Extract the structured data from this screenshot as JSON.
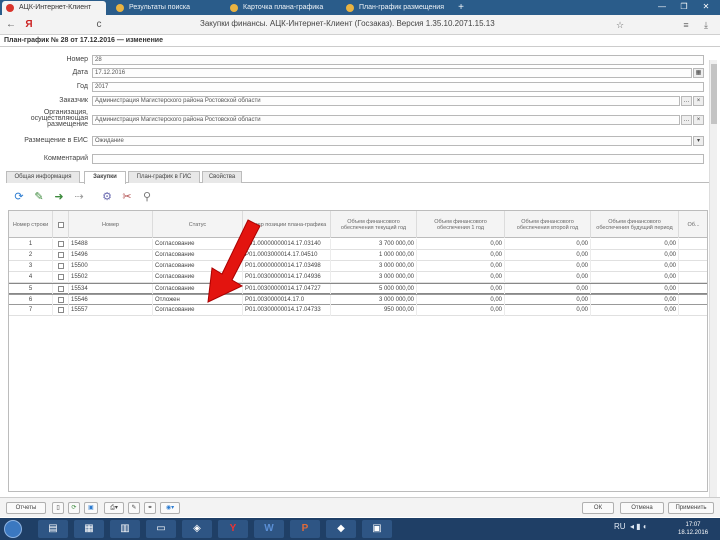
{
  "browser": {
    "tabs": [
      {
        "label": "АЦК-Интернет-Клиент",
        "color": "#d9342b",
        "active": true
      },
      {
        "label": "Результаты поиска",
        "color": "#e9b341",
        "active": false
      },
      {
        "label": "Карточка плана-графика",
        "color": "#e9b341",
        "active": false
      },
      {
        "label": "План-график размещения",
        "color": "#e9b341",
        "active": false
      }
    ],
    "new_tab": "+",
    "back": "←",
    "yandex": "Я",
    "reload": "с",
    "url": "Закупки финансы. АЦК-Интернет-Клиент (Госзаказ). Версия 1.35.10.2071.15.13",
    "window_min": "—",
    "window_max": "❐",
    "window_close": "✕"
  },
  "page": {
    "header": "План-график № 28 от 17.12.2016 — изменение"
  },
  "form": {
    "number_label": "Номер",
    "number_value": "28",
    "date_label": "Дата",
    "date_value": "17.12.2016",
    "year_label": "Год",
    "year_value": "2017",
    "customer_label": "Заказчик",
    "customer_value": "Администрация Магистерского района Ростовской области",
    "org_label": "Организация, осуществляющая размещение",
    "org_value": "Администрация Магистерского района Ростовской области",
    "status_label": "Размещение в ЕИС",
    "status_value": "Ожидание",
    "comment_label": "Комментарий",
    "comment_value": ""
  },
  "content_tabs": [
    {
      "label": "Общая информация",
      "active": false
    },
    {
      "label": "Закупки",
      "active": true
    },
    {
      "label": "План-график в ГИС",
      "active": false
    },
    {
      "label": "Свойства",
      "active": false
    }
  ],
  "toolbar": {
    "icons": [
      "refresh-icon",
      "edit-icon",
      "add-icon",
      "move-icon",
      "settings-icon",
      "tools-icon",
      "filter-icon"
    ]
  },
  "grid": {
    "columns": [
      "Номер строки",
      "",
      "Номер",
      "Статус",
      "Номер позиции плана-графика",
      "Объем финансового обеспечения текущий год",
      "Объем финансового обеспечения 1 год",
      "Объем финансового обеспечения второй год",
      "Объем финансового обеспечения будущий период",
      "Об..."
    ],
    "rows": [
      {
        "line": "1",
        "num": "15488",
        "status": "Согласование",
        "pos": "P01.00000000014.17.03140",
        "cur": "3 700 000,00",
        "y1": "0,00",
        "y2": "0,00",
        "fut": "0,00"
      },
      {
        "line": "2",
        "num": "15496",
        "status": "Согласование",
        "pos": "P01.0003000014.17.04510",
        "cur": "1 000 000,00",
        "y1": "0,00",
        "y2": "0,00",
        "fut": "0,00"
      },
      {
        "line": "3",
        "num": "15500",
        "status": "Согласование",
        "pos": "P01.00000000014.17.03498",
        "cur": "3 000 000,00",
        "y1": "0,00",
        "y2": "0,00",
        "fut": "0,00"
      },
      {
        "line": "4",
        "num": "15502",
        "status": "Согласование",
        "pos": "P01.00300000014.17.04936",
        "cur": "3 000 000,00",
        "y1": "0,00",
        "y2": "0,00",
        "fut": "0,00"
      },
      {
        "line": "5",
        "num": "15534",
        "status": "Согласование",
        "pos": "P01.00300000014.17.04727",
        "cur": "5 000 000,00",
        "y1": "0,00",
        "y2": "0,00",
        "fut": "0,00"
      },
      {
        "line": "6",
        "num": "15546",
        "status": "Отложен",
        "pos": "P01.0030000014.17.0",
        "cur": "3 000 000,00",
        "y1": "0,00",
        "y2": "0,00",
        "fut": "0,00"
      },
      {
        "line": "7",
        "num": "15557",
        "status": "Согласование",
        "pos": "P01.00300000014.17.04733",
        "cur": "950 000,00",
        "y1": "0,00",
        "y2": "0,00",
        "fut": "0,00"
      }
    ]
  },
  "bottom": {
    "left_btn": "Отчеты",
    "ok": "ОК",
    "cancel": "Отмена",
    "apply": "Применить"
  },
  "taskbar": {
    "time": "17:07",
    "date": "18.12.2016",
    "lang": "RU"
  },
  "colors": {
    "accent": "#2a5c8a",
    "arrow": "#e3140f",
    "taskbar": "#1f3f66"
  }
}
